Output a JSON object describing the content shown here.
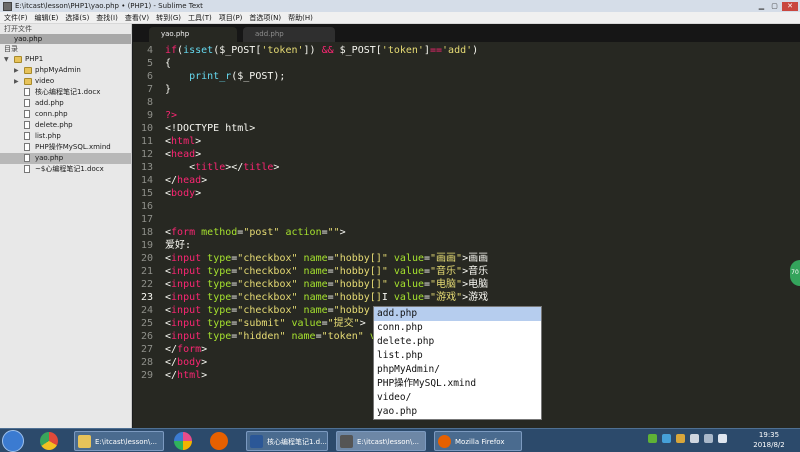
{
  "window": {
    "title": "E:\\itcast\\lesson\\PHP1\\yao.php • (PHP1) - Sublime Text"
  },
  "menu": [
    "文件(F)",
    "编辑(E)",
    "选择(S)",
    "查找(I)",
    "查看(V)",
    "转到(G)",
    "工具(T)",
    "项目(P)",
    "首选项(N)",
    "帮助(H)"
  ],
  "sidebar": {
    "open_files_label": "打开文件",
    "open_file": "yao.php",
    "folders_label": "目录",
    "tree": [
      {
        "label": "PHP1",
        "kind": "folder",
        "depth": 0,
        "expanded": true
      },
      {
        "label": "phpMyAdmin",
        "kind": "folder",
        "depth": 1,
        "expanded": false
      },
      {
        "label": "video",
        "kind": "folder",
        "depth": 1,
        "expanded": false
      },
      {
        "label": "核心编程笔记1.docx",
        "kind": "file",
        "depth": 1
      },
      {
        "label": "add.php",
        "kind": "file",
        "depth": 1
      },
      {
        "label": "conn.php",
        "kind": "file",
        "depth": 1
      },
      {
        "label": "delete.php",
        "kind": "file",
        "depth": 1
      },
      {
        "label": "list.php",
        "kind": "file",
        "depth": 1
      },
      {
        "label": "PHP操作MySQL.xmind",
        "kind": "file",
        "depth": 1
      },
      {
        "label": "yao.php",
        "kind": "file",
        "depth": 1,
        "selected": true
      },
      {
        "label": "~$心编程笔记1.docx",
        "kind": "file",
        "depth": 1
      }
    ]
  },
  "tabs": [
    {
      "label": "yao.php",
      "active": true
    },
    {
      "label": "add.php",
      "active": false
    }
  ],
  "editor": {
    "current_line": 23,
    "lines": [
      {
        "n": 4,
        "tokens": [
          [
            "k",
            "if"
          ],
          [
            "t",
            "("
          ],
          [
            "f",
            "isset"
          ],
          [
            "t",
            "($_POST["
          ],
          [
            "s",
            "'token'"
          ],
          [
            "t",
            "]) "
          ],
          [
            "k",
            "&&"
          ],
          [
            "t",
            " $_POST["
          ],
          [
            "s",
            "'token'"
          ],
          [
            "t",
            "]"
          ],
          [
            "k",
            "=="
          ],
          [
            "s",
            "'add'"
          ],
          [
            "t",
            ")"
          ]
        ]
      },
      {
        "n": 5,
        "tokens": [
          [
            "t",
            "{"
          ]
        ]
      },
      {
        "n": 6,
        "tokens": [
          [
            "t",
            "    "
          ],
          [
            "f",
            "print_r"
          ],
          [
            "t",
            "($_POST);"
          ]
        ]
      },
      {
        "n": 7,
        "tokens": [
          [
            "t",
            "}"
          ]
        ]
      },
      {
        "n": 8,
        "tokens": []
      },
      {
        "n": 9,
        "tokens": [
          [
            "k",
            "?>"
          ]
        ]
      },
      {
        "n": 10,
        "tokens": [
          [
            "t",
            "<!DOCTYPE html>"
          ]
        ]
      },
      {
        "n": 11,
        "tokens": [
          [
            "t",
            "<"
          ],
          [
            "k",
            "html"
          ],
          [
            "t",
            ">"
          ]
        ]
      },
      {
        "n": 12,
        "tokens": [
          [
            "t",
            "<"
          ],
          [
            "k",
            "head"
          ],
          [
            "t",
            ">"
          ]
        ]
      },
      {
        "n": 13,
        "tokens": [
          [
            "t",
            "    <"
          ],
          [
            "k",
            "title"
          ],
          [
            "t",
            "></"
          ],
          [
            "k",
            "title"
          ],
          [
            "t",
            ">"
          ]
        ]
      },
      {
        "n": 14,
        "tokens": [
          [
            "t",
            "</"
          ],
          [
            "k",
            "head"
          ],
          [
            "t",
            ">"
          ]
        ]
      },
      {
        "n": 15,
        "tokens": [
          [
            "t",
            "<"
          ],
          [
            "k",
            "body"
          ],
          [
            "t",
            ">"
          ]
        ]
      },
      {
        "n": 16,
        "tokens": []
      },
      {
        "n": 17,
        "tokens": []
      },
      {
        "n": 18,
        "tokens": [
          [
            "t",
            "<"
          ],
          [
            "k",
            "form"
          ],
          [
            "t",
            " "
          ],
          [
            "a",
            "method"
          ],
          [
            "t",
            "="
          ],
          [
            "s",
            "\"post\""
          ],
          [
            "t",
            " "
          ],
          [
            "a",
            "action"
          ],
          [
            "t",
            "="
          ],
          [
            "s",
            "\"\""
          ],
          [
            "t",
            ">"
          ]
        ]
      },
      {
        "n": 19,
        "tokens": [
          [
            "t",
            "爱好:"
          ]
        ]
      },
      {
        "n": 20,
        "tokens": [
          [
            "t",
            "<"
          ],
          [
            "k",
            "input"
          ],
          [
            "t",
            " "
          ],
          [
            "a",
            "type"
          ],
          [
            "t",
            "="
          ],
          [
            "s",
            "\"checkbox\""
          ],
          [
            "t",
            " "
          ],
          [
            "a",
            "name"
          ],
          [
            "t",
            "="
          ],
          [
            "s",
            "\"hobby[]\""
          ],
          [
            "t",
            " "
          ],
          [
            "a",
            "value"
          ],
          [
            "t",
            "="
          ],
          [
            "s",
            "\"画画\""
          ],
          [
            "t",
            ">画画"
          ]
        ]
      },
      {
        "n": 21,
        "tokens": [
          [
            "t",
            "<"
          ],
          [
            "k",
            "input"
          ],
          [
            "t",
            " "
          ],
          [
            "a",
            "type"
          ],
          [
            "t",
            "="
          ],
          [
            "s",
            "\"checkbox\""
          ],
          [
            "t",
            " "
          ],
          [
            "a",
            "name"
          ],
          [
            "t",
            "="
          ],
          [
            "s",
            "\"hobby[]\""
          ],
          [
            "t",
            " "
          ],
          [
            "a",
            "value"
          ],
          [
            "t",
            "="
          ],
          [
            "s",
            "\"音乐\""
          ],
          [
            "t",
            ">音乐"
          ]
        ]
      },
      {
        "n": 22,
        "tokens": [
          [
            "t",
            "<"
          ],
          [
            "k",
            "input"
          ],
          [
            "t",
            " "
          ],
          [
            "a",
            "type"
          ],
          [
            "t",
            "="
          ],
          [
            "s",
            "\"checkbox\""
          ],
          [
            "t",
            " "
          ],
          [
            "a",
            "name"
          ],
          [
            "t",
            "="
          ],
          [
            "s",
            "\"hobby[]\""
          ],
          [
            "t",
            " "
          ],
          [
            "a",
            "value"
          ],
          [
            "t",
            "="
          ],
          [
            "s",
            "\"电脑\""
          ],
          [
            "t",
            ">电脑"
          ]
        ]
      },
      {
        "n": 23,
        "tokens": [
          [
            "t",
            "<"
          ],
          [
            "k",
            "input"
          ],
          [
            "t",
            " "
          ],
          [
            "a",
            "type"
          ],
          [
            "t",
            "="
          ],
          [
            "s",
            "\"checkbox\""
          ],
          [
            "t",
            " "
          ],
          [
            "a",
            "name"
          ],
          [
            "t",
            "="
          ],
          [
            "s",
            "\"hobby[]"
          ],
          [
            "t",
            "I"
          ],
          [
            "t",
            " "
          ],
          [
            "a",
            "value"
          ],
          [
            "t",
            "="
          ],
          [
            "s",
            "\"游戏\""
          ],
          [
            "t",
            ">游戏"
          ]
        ]
      },
      {
        "n": 24,
        "tokens": [
          [
            "t",
            "<"
          ],
          [
            "k",
            "input"
          ],
          [
            "t",
            " "
          ],
          [
            "a",
            "type"
          ],
          [
            "t",
            "="
          ],
          [
            "s",
            "\"checkbox\""
          ],
          [
            "t",
            " "
          ],
          [
            "a",
            "name"
          ],
          [
            "t",
            "="
          ],
          [
            "s",
            "\"hobby"
          ]
        ]
      },
      {
        "n": 25,
        "tokens": [
          [
            "t",
            "<"
          ],
          [
            "k",
            "input"
          ],
          [
            "t",
            " "
          ],
          [
            "a",
            "type"
          ],
          [
            "t",
            "="
          ],
          [
            "s",
            "\"submit\""
          ],
          [
            "t",
            " "
          ],
          [
            "a",
            "value"
          ],
          [
            "t",
            "="
          ],
          [
            "s",
            "\"提交\""
          ],
          [
            "t",
            ">"
          ]
        ]
      },
      {
        "n": 26,
        "tokens": [
          [
            "t",
            "<"
          ],
          [
            "k",
            "input"
          ],
          [
            "t",
            " "
          ],
          [
            "a",
            "type"
          ],
          [
            "t",
            "="
          ],
          [
            "s",
            "\"hidden\""
          ],
          [
            "t",
            " "
          ],
          [
            "a",
            "name"
          ],
          [
            "t",
            "="
          ],
          [
            "s",
            "\"token\""
          ],
          [
            "t",
            " "
          ],
          [
            "a",
            "va"
          ]
        ]
      },
      {
        "n": 27,
        "tokens": [
          [
            "t",
            "</"
          ],
          [
            "k",
            "form"
          ],
          [
            "t",
            ">"
          ]
        ]
      },
      {
        "n": 28,
        "tokens": [
          [
            "t",
            "</"
          ],
          [
            "k",
            "body"
          ],
          [
            "t",
            ">"
          ]
        ]
      },
      {
        "n": 29,
        "tokens": [
          [
            "t",
            "</"
          ],
          [
            "k",
            "html"
          ],
          [
            "t",
            ">"
          ]
        ]
      }
    ]
  },
  "autocomplete": {
    "selected": 0,
    "items": [
      "add.php",
      "conn.php",
      "delete.php",
      "list.php",
      "phpMyAdmin/",
      "PHP操作MySQL.xmind",
      "video/",
      "yao.php"
    ]
  },
  "scroll_badge": "70",
  "taskbar": {
    "tasks": [
      {
        "label": "E:\\itcast\\lesson\\...",
        "icon": "folder-icon",
        "color": "#e7c35a"
      },
      {
        "label": "核心编程笔记1.d...",
        "icon": "word-icon",
        "color": "#2b5797"
      },
      {
        "label": "E:\\itcast\\lesson\\...",
        "icon": "sublime-icon",
        "color": "#555555"
      },
      {
        "label": "Mozilla Firefox",
        "icon": "firefox-icon",
        "color": "#e66000"
      }
    ],
    "clock_time": "19:35",
    "clock_date": "2018/8/2"
  }
}
